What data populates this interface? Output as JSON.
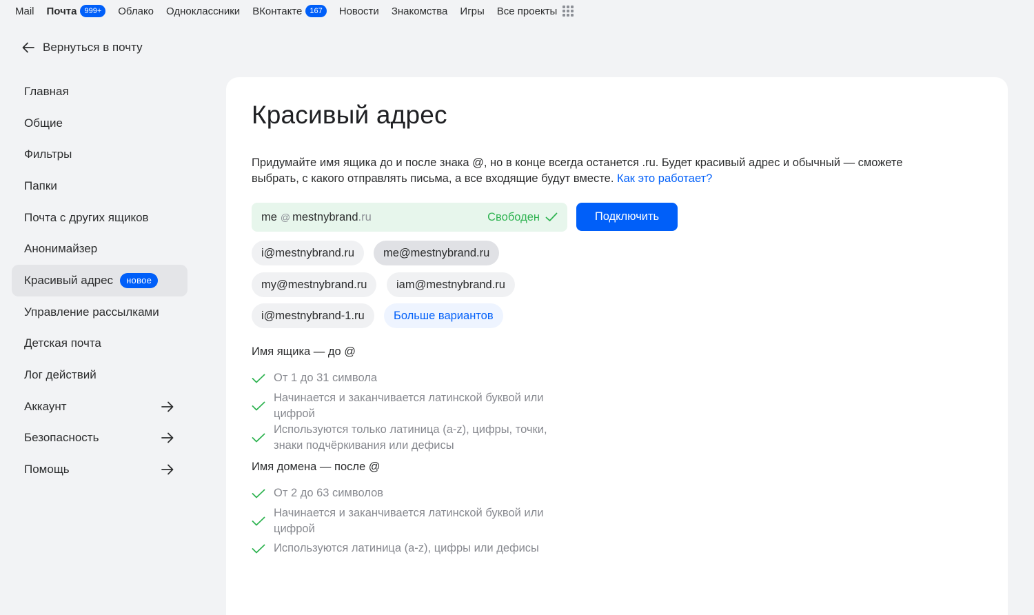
{
  "topbar": {
    "items": [
      {
        "label": "Mail"
      },
      {
        "label": "Почта",
        "badge": "999+"
      },
      {
        "label": "Облако"
      },
      {
        "label": "Одноклассники"
      },
      {
        "label": "ВКонтакте",
        "badge": "167"
      },
      {
        "label": "Новости"
      },
      {
        "label": "Знакомства"
      },
      {
        "label": "Игры"
      },
      {
        "label": "Все проекты"
      }
    ]
  },
  "back": {
    "label": "Вернуться в почту"
  },
  "sidebar": {
    "items": [
      {
        "label": "Главная"
      },
      {
        "label": "Общие"
      },
      {
        "label": "Фильтры"
      },
      {
        "label": "Папки"
      },
      {
        "label": "Почта с других ящиков"
      },
      {
        "label": "Анонимайзер"
      },
      {
        "label": "Красивый адрес",
        "badge": "новое"
      },
      {
        "label": "Управление рассылками"
      },
      {
        "label": "Детская почта"
      },
      {
        "label": "Лог действий"
      },
      {
        "label": "Аккаунт"
      },
      {
        "label": "Безопасность"
      },
      {
        "label": "Помощь"
      }
    ]
  },
  "main": {
    "title": "Красивый адрес",
    "description": "Придумайте имя ящика до и после знака @, но в конце всегда останется .ru. Будет красивый адрес и обычный — сможете выбрать, с какого отправлять письма, а все входящие будут вместе.",
    "help_link": "Как это работает?",
    "address": {
      "name": "me",
      "at": "@",
      "domain": "mestnybrand",
      "tld": ".ru",
      "status": "Свободен"
    },
    "connect_label": "Подключить",
    "suggestions": [
      "i@mestnybrand.ru",
      "me@mestnybrand.ru",
      "my@mestnybrand.ru",
      "iam@mestnybrand.ru",
      "i@mestnybrand-1.ru"
    ],
    "more_label": "Больше вариантов",
    "mailbox_rules": {
      "title": "Имя ящика — до @",
      "rules": [
        "От 1 до 31 символа",
        "Начинается и заканчивается латинской буквой или цифрой",
        "Используются только латиница (a-z), цифры, точки, знаки подчёркивания или дефисы"
      ]
    },
    "domain_rules": {
      "title": "Имя домена — после @",
      "rules": [
        "От 2 до 63 символов",
        "Начинается и заканчивается латинской буквой или цифрой",
        "Используются латиница (a-z), цифры или дефисы"
      ]
    }
  },
  "colors": {
    "accent": "#005ff9",
    "success": "#2fb351",
    "page_bg": "#f2f3f5"
  }
}
